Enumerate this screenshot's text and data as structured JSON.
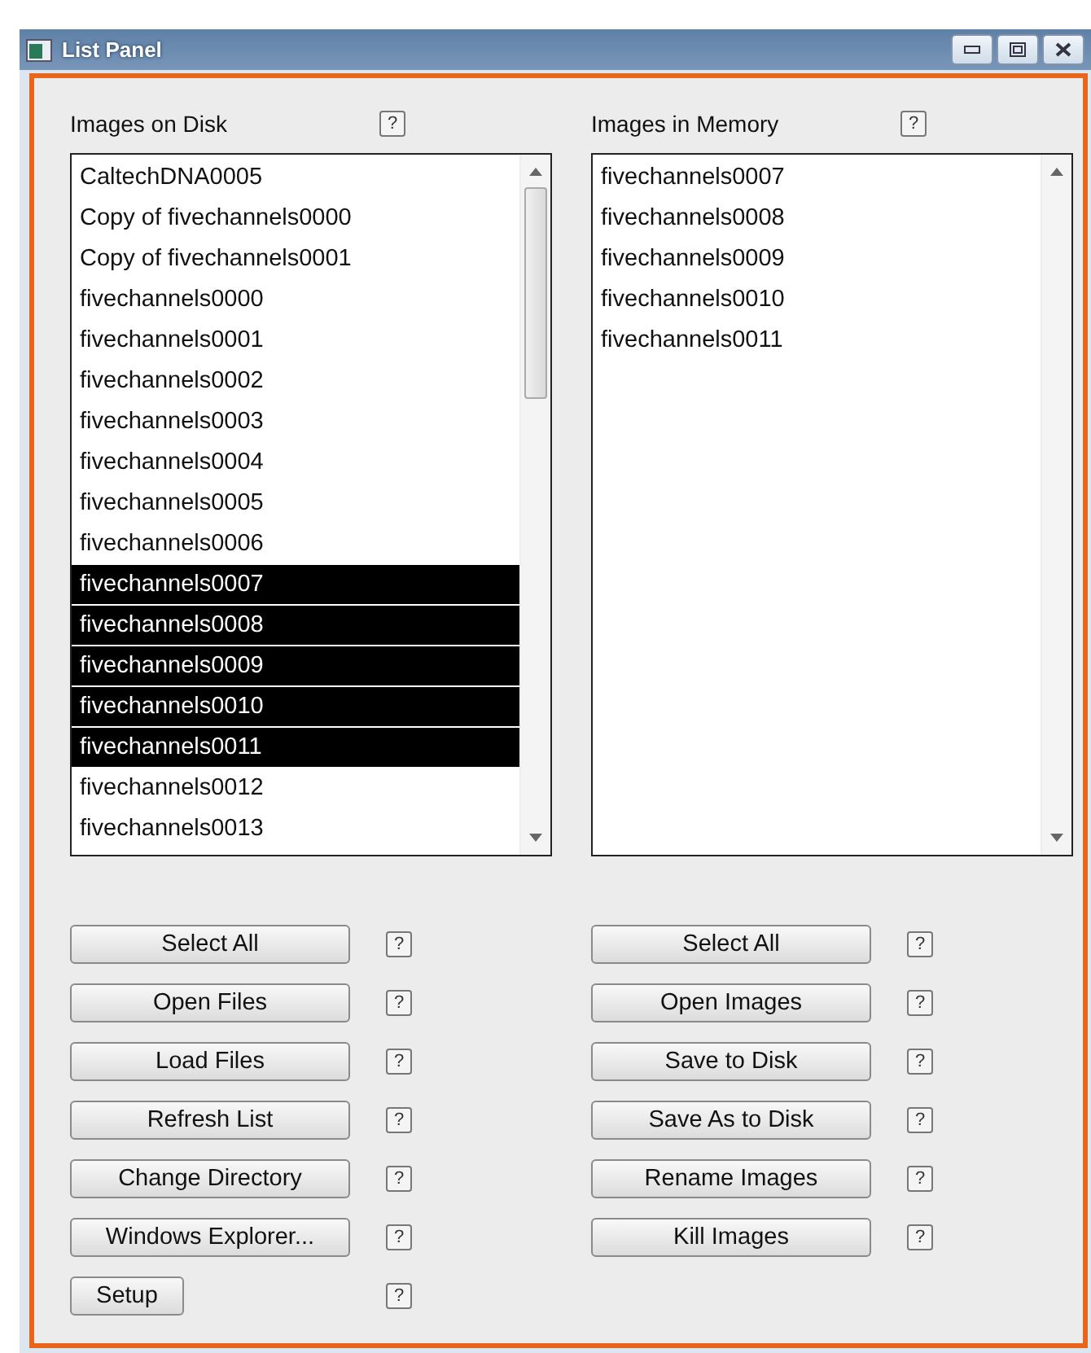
{
  "window": {
    "title": "List Panel"
  },
  "disk": {
    "label": "Images on Disk",
    "help": "?",
    "items": [
      {
        "name": "CaltechDNA0005",
        "selected": false
      },
      {
        "name": "Copy of fivechannels0000",
        "selected": false
      },
      {
        "name": "Copy of fivechannels0001",
        "selected": false
      },
      {
        "name": "fivechannels0000",
        "selected": false
      },
      {
        "name": "fivechannels0001",
        "selected": false
      },
      {
        "name": "fivechannels0002",
        "selected": false
      },
      {
        "name": "fivechannels0003",
        "selected": false
      },
      {
        "name": "fivechannels0004",
        "selected": false
      },
      {
        "name": "fivechannels0005",
        "selected": false
      },
      {
        "name": "fivechannels0006",
        "selected": false
      },
      {
        "name": "fivechannels0007",
        "selected": true
      },
      {
        "name": "fivechannels0008",
        "selected": true
      },
      {
        "name": "fivechannels0009",
        "selected": true
      },
      {
        "name": "fivechannels0010",
        "selected": true
      },
      {
        "name": "fivechannels0011",
        "selected": true
      },
      {
        "name": "fivechannels0012",
        "selected": false
      },
      {
        "name": "fivechannels0013",
        "selected": false
      }
    ],
    "buttons": [
      {
        "label": "Select All",
        "help": "?"
      },
      {
        "label": "Open Files",
        "help": "?"
      },
      {
        "label": "Load Files",
        "help": "?"
      },
      {
        "label": "Refresh List",
        "help": "?"
      },
      {
        "label": "Change Directory",
        "help": "?"
      },
      {
        "label": "Windows Explorer...",
        "help": "?"
      },
      {
        "label": "Setup",
        "help": "?",
        "kind": "short"
      }
    ]
  },
  "memory": {
    "label": "Images in Memory",
    "help": "?",
    "items": [
      {
        "name": "fivechannels0007",
        "selected": false
      },
      {
        "name": "fivechannels0008",
        "selected": false
      },
      {
        "name": "fivechannels0009",
        "selected": false
      },
      {
        "name": "fivechannels0010",
        "selected": false
      },
      {
        "name": "fivechannels0011",
        "selected": false
      }
    ],
    "buttons": [
      {
        "label": "Select All",
        "help": "?"
      },
      {
        "label": "Open Images",
        "help": "?"
      },
      {
        "label": "Save to Disk",
        "help": "?"
      },
      {
        "label": "Save As to Disk",
        "help": "?"
      },
      {
        "label": "Rename Images",
        "help": "?"
      },
      {
        "label": "Kill Images",
        "help": "?"
      }
    ]
  }
}
